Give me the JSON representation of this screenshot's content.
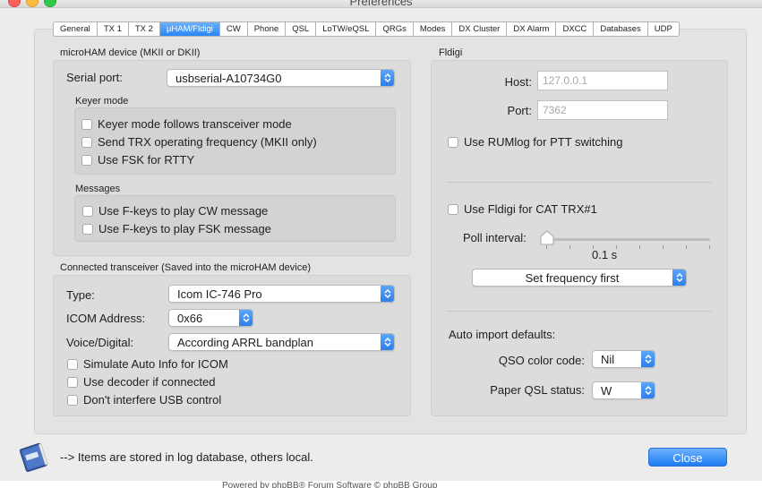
{
  "window": {
    "title": "Preferences"
  },
  "tabs": [
    "General",
    "TX 1",
    "TX 2",
    "µHAM/Fldigi",
    "CW",
    "Phone",
    "QSL",
    "LoTW/eQSL",
    "QRGs",
    "Modes",
    "DX Cluster",
    "DX Alarm",
    "DXCC",
    "Databases",
    "UDP"
  ],
  "active_tab": "µHAM/Fldigi",
  "microham": {
    "group_label": "microHAM device (MKII or DKII)",
    "serial_port_label": "Serial port:",
    "serial_port_value": "usbserial-A10734G0",
    "keyer_label": "Keyer mode",
    "keyer_options": [
      "Keyer mode follows transceiver mode",
      "Send TRX operating frequency (MKII only)",
      "Use FSK for RTTY"
    ],
    "messages_label": "Messages",
    "messages_options": [
      "Use F-keys to play CW message",
      "Use F-keys to play FSK message"
    ]
  },
  "transceiver": {
    "group_label": "Connected transceiver (Saved into the microHAM device)",
    "type_label": "Type:",
    "type_value": "Icom IC-746 Pro",
    "icom_address_label": "ICOM Address:",
    "icom_address_value": "0x66",
    "voice_label": "Voice/Digital:",
    "voice_value": "According ARRL bandplan",
    "options": [
      "Simulate Auto Info for ICOM",
      "Use decoder if connected",
      "Don't interfere USB control"
    ]
  },
  "fldigi": {
    "group_label": "Fldigi",
    "host_label": "Host:",
    "host_placeholder": "127.0.0.1",
    "port_label": "Port:",
    "port_placeholder": "7362",
    "ptt_option": "Use RUMlog for PTT switching",
    "cat_option": "Use Fldigi for CAT TRX#1",
    "poll_label": "Poll interval:",
    "poll_value": "0.1 s",
    "poll_level": 0,
    "freq_popup": "Set frequency first",
    "auto_import_label": "Auto import defaults:",
    "qso_color_label": "QSO color code:",
    "qso_color_value": "Nil",
    "paper_qsl_label": "Paper QSL status:",
    "paper_qsl_value": "W"
  },
  "footer": {
    "note": "--> Items are stored in log database, others local.",
    "close_label": "Close",
    "bottom_text": "Powered by phpBB® Forum Software © phpBB Group"
  },
  "colors": {
    "accent": "#2a86f4",
    "panel": "#e3e3e3"
  }
}
